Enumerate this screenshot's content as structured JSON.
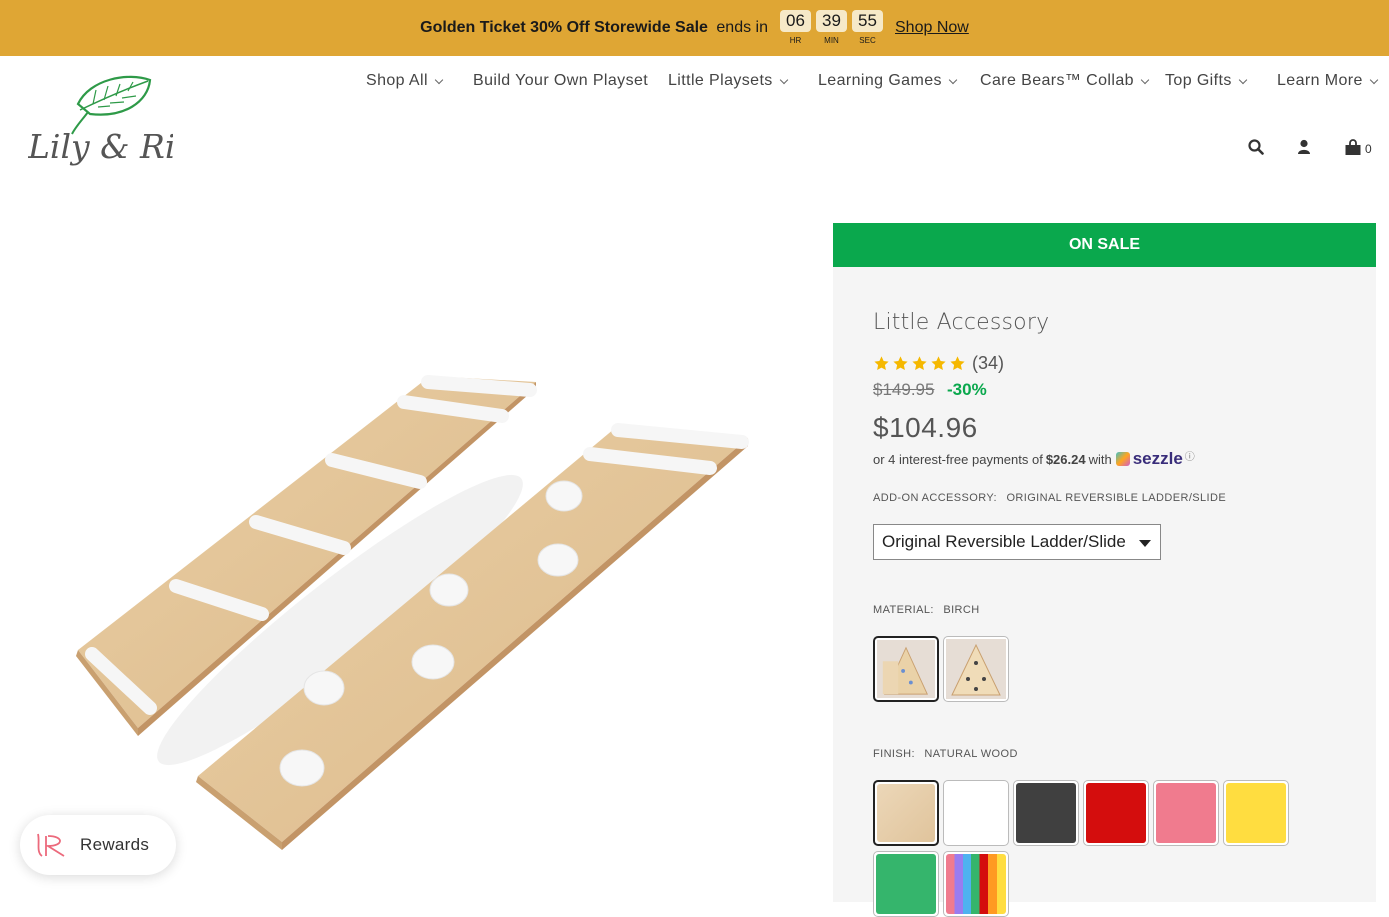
{
  "announcement": {
    "bold": "Golden Ticket 30% Off Storewide Sale",
    "rest": "ends in",
    "timer": [
      {
        "value": "06",
        "label": "HR"
      },
      {
        "value": "39",
        "label": "MIN"
      },
      {
        "value": "55",
        "label": "SEC"
      }
    ],
    "cta": "Shop Now",
    "bg_color": "#dfa634"
  },
  "header": {
    "logo_text": "Lily & River",
    "nav": [
      {
        "label": "Shop All",
        "has_dropdown": true
      },
      {
        "label": "Build Your Own Playset",
        "has_dropdown": false
      },
      {
        "label": "Little Playsets",
        "has_dropdown": true
      },
      {
        "label": "Learning Games",
        "has_dropdown": true
      },
      {
        "label": "Care Bears™ Collab",
        "has_dropdown": true
      },
      {
        "label": "Top Gifts",
        "has_dropdown": true
      },
      {
        "label": "Learn More",
        "has_dropdown": true
      }
    ],
    "icons": [
      "search-icon",
      "account-icon",
      "cart-icon"
    ],
    "cart_count": "0"
  },
  "rewards": {
    "label": "Rewards"
  },
  "product": {
    "sale_banner": "ON SALE",
    "sale_color": "#0aa84d",
    "title": "Little Accessory",
    "rating": 5,
    "review_count": "(34)",
    "old_price": "$149.95",
    "discount": "-30%",
    "price": "$104.96",
    "sezzle": {
      "prefix": "or 4 interest-free payments of",
      "amount": "$26.24",
      "suffix": "with",
      "brand": "sezzle",
      "info": "ⓘ"
    },
    "addon": {
      "label": "ADD-ON ACCESSORY:",
      "value": "ORIGINAL REVERSIBLE LADDER/SLIDE",
      "selected": "Original Reversible Ladder/Slide"
    },
    "material": {
      "label": "MATERIAL:",
      "value": "BIRCH",
      "options": [
        {
          "name": "birch",
          "selected": true
        },
        {
          "name": "maple",
          "selected": false
        }
      ]
    },
    "finish": {
      "label": "FINISH:",
      "value": "NATURAL WOOD",
      "options": [
        {
          "name": "natural-wood",
          "color": "#e8d3b3",
          "selected": true
        },
        {
          "name": "white",
          "color": "#ffffff",
          "selected": false
        },
        {
          "name": "charcoal",
          "color": "#404040",
          "selected": false
        },
        {
          "name": "red",
          "color": "#d40d0d",
          "selected": false
        },
        {
          "name": "pink",
          "color": "#f07b8e",
          "selected": false
        },
        {
          "name": "yellow",
          "color": "#ffdd40",
          "selected": false
        },
        {
          "name": "green",
          "color": "#35b56c",
          "selected": false
        },
        {
          "name": "rainbow",
          "color": "rainbow",
          "selected": false
        }
      ]
    }
  }
}
